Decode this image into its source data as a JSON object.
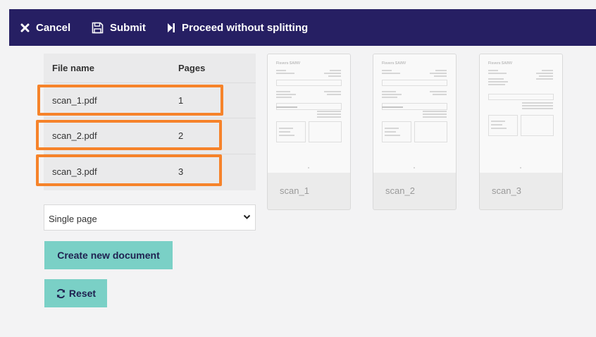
{
  "toolbar": {
    "cancel_label": "Cancel",
    "submit_label": "Submit",
    "proceed_label": "Proceed without splitting"
  },
  "table": {
    "headers": [
      "File name",
      "Pages"
    ],
    "rows": [
      {
        "file": "scan_1.pdf",
        "pages": "1"
      },
      {
        "file": "scan_2.pdf",
        "pages": "2"
      },
      {
        "file": "scan_3.pdf",
        "pages": "3"
      }
    ]
  },
  "split_mode": {
    "selected": "Single page"
  },
  "actions": {
    "create_label": "Create new document",
    "reset_label": "Reset"
  },
  "previews": [
    {
      "label": "scan_1",
      "doc_header": "Fisvers SA/NV"
    },
    {
      "label": "scan_2",
      "doc_header": "Fisvers SA/NV"
    },
    {
      "label": "scan_3",
      "doc_header": "Fisvers SA/NV"
    }
  ],
  "colors": {
    "toolbar_bg": "#261f63",
    "highlight": "#f6832a",
    "button_bg": "#7ad0c6",
    "button_text": "#1f2150"
  },
  "icons": {
    "cancel": "x-icon",
    "submit": "floppy-disk-icon",
    "proceed": "skip-forward-icon",
    "reset": "refresh-icon",
    "select": "chevron-down-icon"
  }
}
